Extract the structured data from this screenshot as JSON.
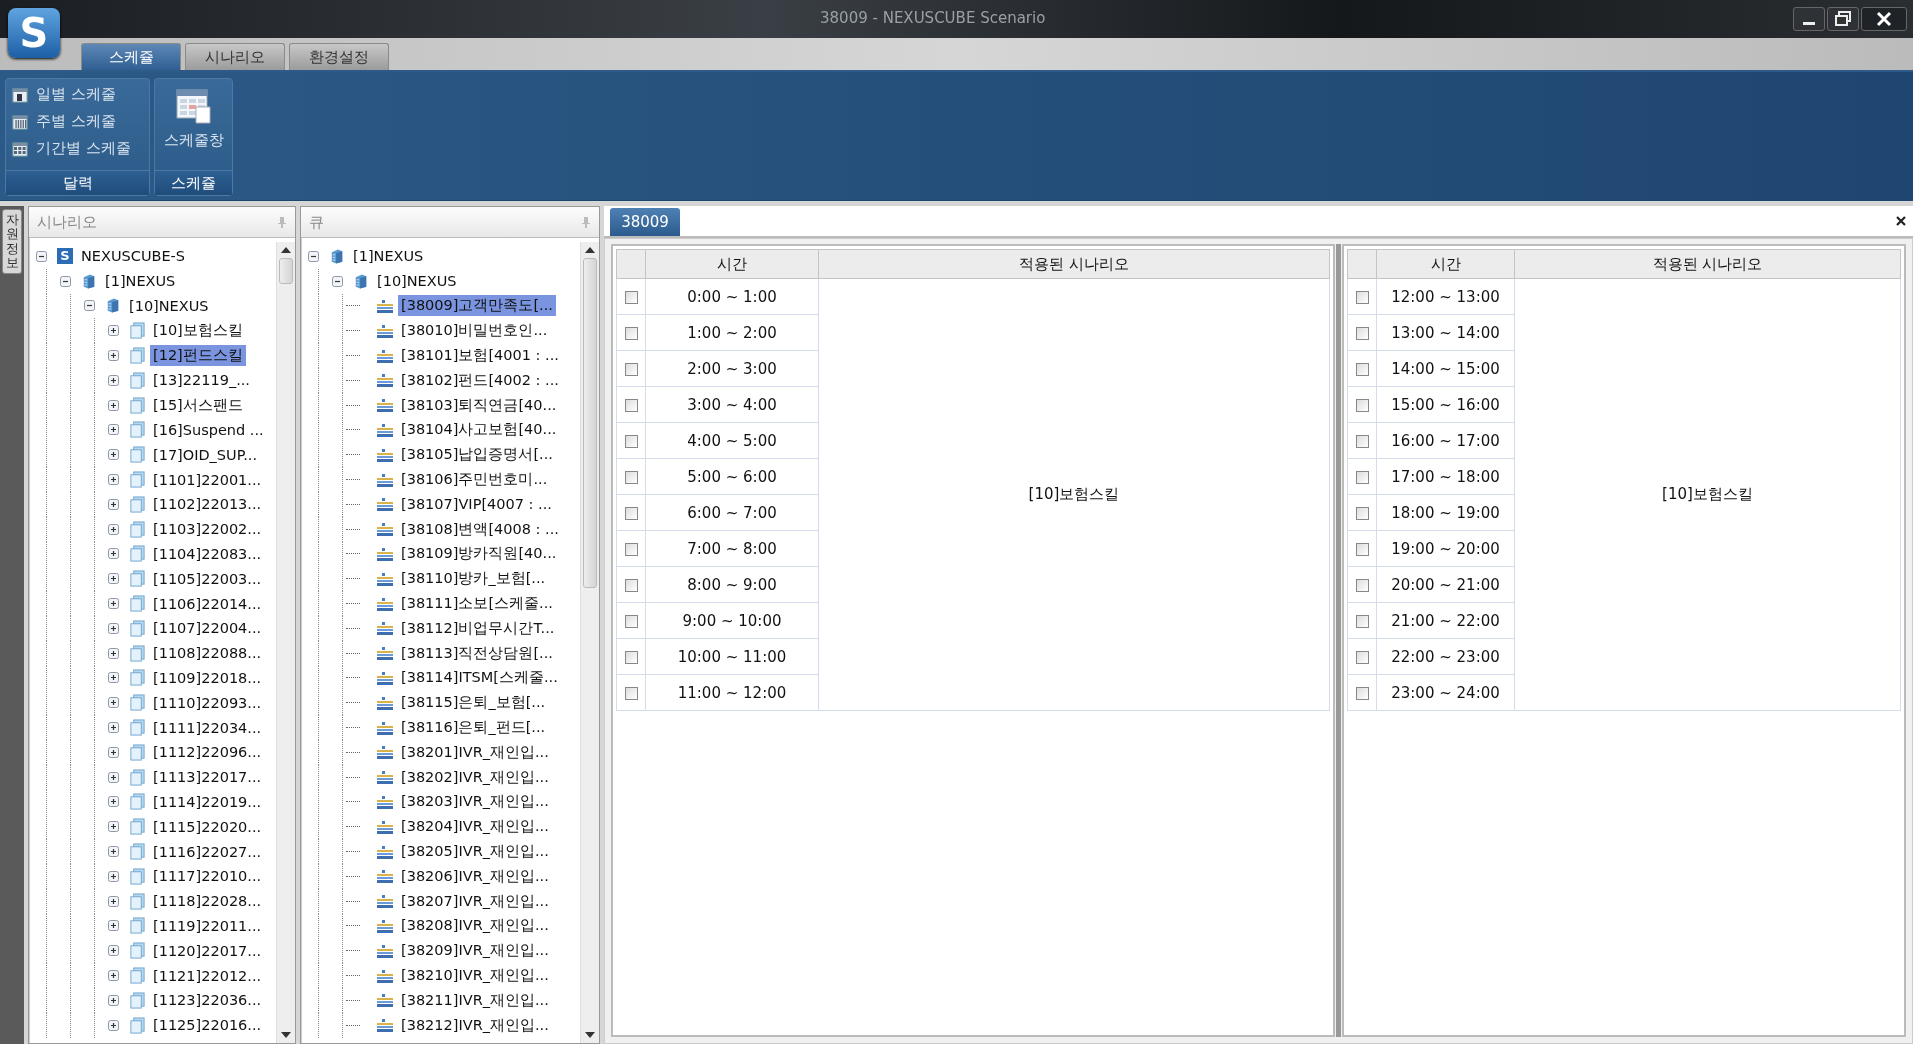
{
  "window": {
    "title": "38009 - NEXUSCUBE Scenario",
    "logo_letter": "S"
  },
  "ribbon": {
    "tabs": [
      {
        "label": "스케쥴",
        "selected": true
      },
      {
        "label": "시나리오",
        "selected": false
      },
      {
        "label": "환경설정",
        "selected": false
      }
    ],
    "groups": [
      {
        "kind": "list",
        "label": "달력",
        "items": [
          {
            "label": "일별 스케줄",
            "kind": "day"
          },
          {
            "label": "주별 스케줄",
            "kind": "week"
          },
          {
            "label": "기간별 스케줄",
            "kind": "period"
          }
        ]
      },
      {
        "kind": "large",
        "label": "스케쥴",
        "items": [
          {
            "label": "스케줄창"
          }
        ]
      }
    ]
  },
  "side_tab": {
    "label": "자원정보"
  },
  "scenario_panel": {
    "title": "시나리오",
    "tree": [
      {
        "label": "NEXUSCUBE-S",
        "kind": "root",
        "icon_letter": "S",
        "expanded": true,
        "selected": false,
        "children": [
          {
            "label": "[1]NEXUS",
            "kind": "site",
            "expanded": true,
            "selected": false,
            "children": [
              {
                "label": "[10]NEXUS",
                "kind": "site",
                "expanded": true,
                "selected": false,
                "children": [
                  {
                    "label": "[10]보험스킬",
                    "kind": "scenario",
                    "expanded": false,
                    "selected": false
                  },
                  {
                    "label": "[12]펀드스킬",
                    "kind": "scenario",
                    "expanded": false,
                    "selected": true
                  },
                  {
                    "label": "[13]22119_...",
                    "kind": "scenario",
                    "expanded": false,
                    "selected": false
                  },
                  {
                    "label": "[15]서스팬드",
                    "kind": "scenario",
                    "expanded": false,
                    "selected": false
                  },
                  {
                    "label": "[16]Suspend ...",
                    "kind": "scenario",
                    "expanded": false,
                    "selected": false
                  },
                  {
                    "label": "[17]OID_SUP...",
                    "kind": "scenario",
                    "expanded": false,
                    "selected": false
                  },
                  {
                    "label": "[1101]22001...",
                    "kind": "scenario",
                    "expanded": false,
                    "selected": false
                  },
                  {
                    "label": "[1102]22013...",
                    "kind": "scenario",
                    "expanded": false,
                    "selected": false
                  },
                  {
                    "label": "[1103]22002...",
                    "kind": "scenario",
                    "expanded": false,
                    "selected": false
                  },
                  {
                    "label": "[1104]22083...",
                    "kind": "scenario",
                    "expanded": false,
                    "selected": false
                  },
                  {
                    "label": "[1105]22003...",
                    "kind": "scenario",
                    "expanded": false,
                    "selected": false
                  },
                  {
                    "label": "[1106]22014...",
                    "kind": "scenario",
                    "expanded": false,
                    "selected": false
                  },
                  {
                    "label": "[1107]22004...",
                    "kind": "scenario",
                    "expanded": false,
                    "selected": false
                  },
                  {
                    "label": "[1108]22088...",
                    "kind": "scenario",
                    "expanded": false,
                    "selected": false
                  },
                  {
                    "label": "[1109]22018...",
                    "kind": "scenario",
                    "expanded": false,
                    "selected": false
                  },
                  {
                    "label": "[1110]22093...",
                    "kind": "scenario",
                    "expanded": false,
                    "selected": false
                  },
                  {
                    "label": "[1111]22034...",
                    "kind": "scenario",
                    "expanded": false,
                    "selected": false
                  },
                  {
                    "label": "[1112]22096...",
                    "kind": "scenario",
                    "expanded": false,
                    "selected": false
                  },
                  {
                    "label": "[1113]22017...",
                    "kind": "scenario",
                    "expanded": false,
                    "selected": false
                  },
                  {
                    "label": "[1114]22019...",
                    "kind": "scenario",
                    "expanded": false,
                    "selected": false
                  },
                  {
                    "label": "[1115]22020...",
                    "kind": "scenario",
                    "expanded": false,
                    "selected": false
                  },
                  {
                    "label": "[1116]22027...",
                    "kind": "scenario",
                    "expanded": false,
                    "selected": false
                  },
                  {
                    "label": "[1117]22010...",
                    "kind": "scenario",
                    "expanded": false,
                    "selected": false
                  },
                  {
                    "label": "[1118]22028...",
                    "kind": "scenario",
                    "expanded": false,
                    "selected": false
                  },
                  {
                    "label": "[1119]22011...",
                    "kind": "scenario",
                    "expanded": false,
                    "selected": false
                  },
                  {
                    "label": "[1120]22017...",
                    "kind": "scenario",
                    "expanded": false,
                    "selected": false
                  },
                  {
                    "label": "[1121]22012...",
                    "kind": "scenario",
                    "expanded": false,
                    "selected": false
                  },
                  {
                    "label": "[1123]22036...",
                    "kind": "scenario",
                    "expanded": false,
                    "selected": false
                  },
                  {
                    "label": "[1125]22016...",
                    "kind": "scenario",
                    "expanded": false,
                    "selected": false
                  }
                ]
              }
            ]
          }
        ]
      }
    ]
  },
  "queue_panel": {
    "title": "큐",
    "tree": [
      {
        "label": "[1]NEXUS",
        "kind": "site",
        "expanded": true,
        "selected": false,
        "children": [
          {
            "label": "[10]NEXUS",
            "kind": "site",
            "expanded": true,
            "selected": false,
            "children": [
              {
                "label": "[38009]고객만족도[...",
                "kind": "queue",
                "selected": true
              },
              {
                "label": "[38010]비밀번호인...",
                "kind": "queue",
                "selected": false
              },
              {
                "label": "[38101]보험[4001 : ...",
                "kind": "queue",
                "selected": false
              },
              {
                "label": "[38102]펀드[4002 : ...",
                "kind": "queue",
                "selected": false
              },
              {
                "label": "[38103]퇴직연금[40...",
                "kind": "queue",
                "selected": false
              },
              {
                "label": "[38104]사고보험[40...",
                "kind": "queue",
                "selected": false
              },
              {
                "label": "[38105]납입증명서[...",
                "kind": "queue",
                "selected": false
              },
              {
                "label": "[38106]주민번호미...",
                "kind": "queue",
                "selected": false
              },
              {
                "label": "[38107]VIP[4007 : ...",
                "kind": "queue",
                "selected": false
              },
              {
                "label": "[38108]변액[4008 : ...",
                "kind": "queue",
                "selected": false
              },
              {
                "label": "[38109]방카직원[40...",
                "kind": "queue",
                "selected": false
              },
              {
                "label": "[38110]방카_보험[...",
                "kind": "queue",
                "selected": false
              },
              {
                "label": "[38111]소보[스케줄...",
                "kind": "queue",
                "selected": false
              },
              {
                "label": "[38112]비업무시간T...",
                "kind": "queue",
                "selected": false
              },
              {
                "label": "[38113]직전상담원[...",
                "kind": "queue",
                "selected": false
              },
              {
                "label": "[38114]ITSM[스케줄...",
                "kind": "queue",
                "selected": false
              },
              {
                "label": "[38115]은퇴_보험[...",
                "kind": "queue",
                "selected": false
              },
              {
                "label": "[38116]은퇴_펀드[...",
                "kind": "queue",
                "selected": false
              },
              {
                "label": "[38201]IVR_재인입...",
                "kind": "queue",
                "selected": false
              },
              {
                "label": "[38202]IVR_재인입...",
                "kind": "queue",
                "selected": false
              },
              {
                "label": "[38203]IVR_재인입...",
                "kind": "queue",
                "selected": false
              },
              {
                "label": "[38204]IVR_재인입...",
                "kind": "queue",
                "selected": false
              },
              {
                "label": "[38205]IVR_재인입...",
                "kind": "queue",
                "selected": false
              },
              {
                "label": "[38206]IVR_재인입...",
                "kind": "queue",
                "selected": false
              },
              {
                "label": "[38207]IVR_재인입...",
                "kind": "queue",
                "selected": false
              },
              {
                "label": "[38208]IVR_재인입...",
                "kind": "queue",
                "selected": false
              },
              {
                "label": "[38209]IVR_재인입...",
                "kind": "queue",
                "selected": false
              },
              {
                "label": "[38210]IVR_재인입...",
                "kind": "queue",
                "selected": false
              },
              {
                "label": "[38211]IVR_재인입...",
                "kind": "queue",
                "selected": false
              },
              {
                "label": "[38212]IVR_재인입...",
                "kind": "queue",
                "selected": false
              }
            ]
          }
        ]
      }
    ]
  },
  "schedule": {
    "tabs": [
      {
        "label": "38009",
        "selected": true
      }
    ],
    "tables": [
      {
        "columns": [
          "시간",
          "적용된 시나리오"
        ],
        "scenario": "[10]보험스킬",
        "rows": [
          {
            "time": "0:00 ~ 1:00",
            "checked": false
          },
          {
            "time": "1:00 ~ 2:00",
            "checked": false
          },
          {
            "time": "2:00 ~ 3:00",
            "checked": false
          },
          {
            "time": "3:00 ~ 4:00",
            "checked": false
          },
          {
            "time": "4:00 ~ 5:00",
            "checked": false
          },
          {
            "time": "5:00 ~ 6:00",
            "checked": false
          },
          {
            "time": "6:00 ~ 7:00",
            "checked": false
          },
          {
            "time": "7:00 ~ 8:00",
            "checked": false
          },
          {
            "time": "8:00 ~ 9:00",
            "checked": false
          },
          {
            "time": "9:00 ~ 10:00",
            "checked": false
          },
          {
            "time": "10:00 ~ 11:00",
            "checked": false
          },
          {
            "time": "11:00 ~ 12:00",
            "checked": false
          }
        ]
      },
      {
        "columns": [
          "시간",
          "적용된 시나리오"
        ],
        "scenario": "[10]보험스킬",
        "rows": [
          {
            "time": "12:00 ~ 13:00",
            "checked": false
          },
          {
            "time": "13:00 ~ 14:00",
            "checked": false
          },
          {
            "time": "14:00 ~ 15:00",
            "checked": false
          },
          {
            "time": "15:00 ~ 16:00",
            "checked": false
          },
          {
            "time": "16:00 ~ 17:00",
            "checked": false
          },
          {
            "time": "17:00 ~ 18:00",
            "checked": false
          },
          {
            "time": "18:00 ~ 19:00",
            "checked": false
          },
          {
            "time": "19:00 ~ 20:00",
            "checked": false
          },
          {
            "time": "20:00 ~ 21:00",
            "checked": false
          },
          {
            "time": "21:00 ~ 22:00",
            "checked": false
          },
          {
            "time": "22:00 ~ 23:00",
            "checked": false
          },
          {
            "time": "23:00 ~ 24:00",
            "checked": false
          }
        ]
      }
    ]
  }
}
